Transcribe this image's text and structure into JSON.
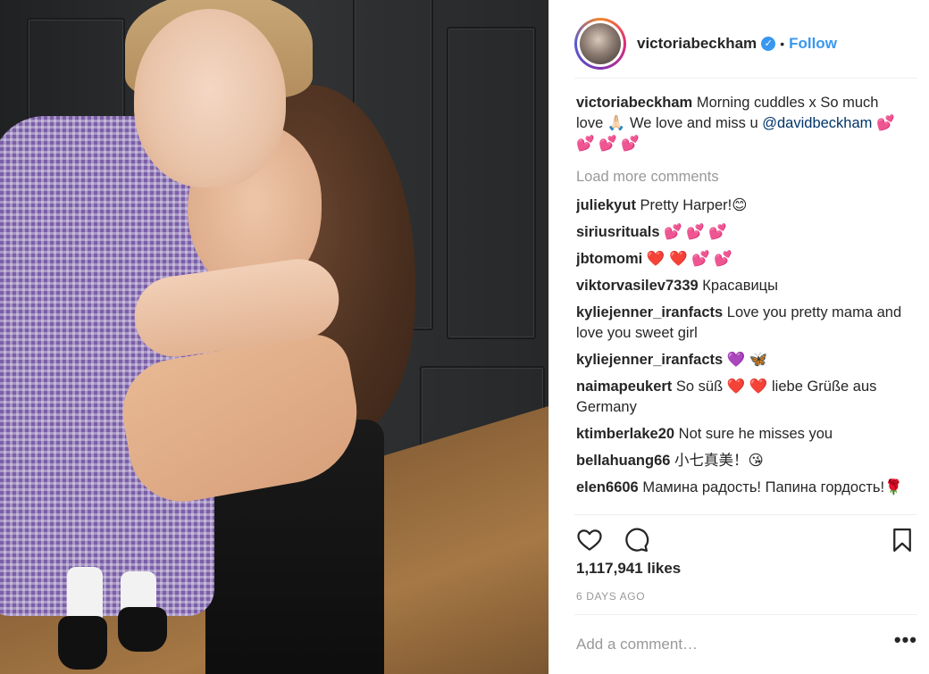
{
  "post": {
    "username": "victoriabeckham",
    "verified_icon": "verified-badge-icon",
    "dot": "•",
    "follow_label": "Follow",
    "caption": {
      "username": "victoriabeckham",
      "text_before_mention": "Morning cuddles x So much love 🙏🏻  We love and miss u",
      "mention": "@davidbeckham",
      "text_after_mention": "💕 💕 💕 💕"
    },
    "load_more_label": "Load more comments",
    "comments": [
      {
        "user": "juliekyut",
        "text": "Pretty Harper!😊"
      },
      {
        "user": "siriusrituals",
        "text": "💕 💕 💕"
      },
      {
        "user": "jbtomomi",
        "text": "❤️ ❤️ 💕 💕"
      },
      {
        "user": "viktorvasilev7339",
        "text": "Красавицы"
      },
      {
        "user": "kyliejenner_iranfacts",
        "text": "Love you pretty mama and love you sweet girl"
      },
      {
        "user": "kyliejenner_iranfacts",
        "text": "💜 🦋"
      },
      {
        "user": "naimapeukert",
        "text": "So süß ❤️ ❤️  liebe Grüße aus Germany"
      },
      {
        "user": "ktimberlake20",
        "text": "Not sure he misses you"
      },
      {
        "user": "bellahuang66",
        "text": "小七真美！😘"
      },
      {
        "user": "elen6606",
        "text": "Мамина радость! Папина гордость!🌹"
      }
    ],
    "actions": {
      "like_icon": "heart-icon",
      "comment_icon": "comment-bubble-icon",
      "save_icon": "bookmark-icon"
    },
    "likes": "1,117,941 likes",
    "timestamp": "6 DAYS AGO",
    "add_comment_placeholder": "Add a comment…",
    "more_options": "•••"
  },
  "colors": {
    "accent": "#3897f0",
    "mention": "#003569",
    "muted": "#999999"
  }
}
